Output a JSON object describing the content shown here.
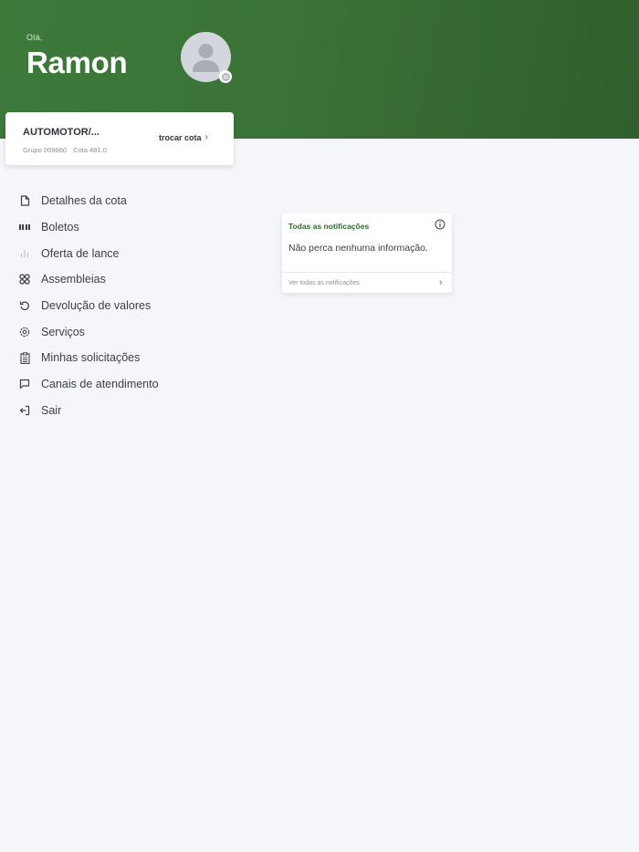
{
  "header": {
    "greeting": "Olá,",
    "user_name": "Ramon",
    "colors": {
      "gradient_start": "#3d7a3a",
      "gradient_end": "#2f5f2c"
    }
  },
  "quota_card": {
    "title": "AUTOMOTOR/...",
    "group": "Grupo 009660",
    "quota": "Cota 481.0",
    "switch_label": "trocar cota",
    "switch_icon": "chevron-right-icon"
  },
  "menu": {
    "items": [
      {
        "label": "Detalhes da cota",
        "icon": "document-icon"
      },
      {
        "label": "Boletos",
        "icon": "barcode-icon"
      },
      {
        "label": "Oferta de lance",
        "icon": "bar-chart-icon"
      },
      {
        "label": "Assembleias",
        "icon": "cluster-icon"
      },
      {
        "label": "Devolução de valores",
        "icon": "undo-icon"
      },
      {
        "label": "Serviços",
        "icon": "gear-icon"
      },
      {
        "label": "Minhas solicitações",
        "icon": "clipboard-icon"
      },
      {
        "label": "Canais de atendimento",
        "icon": "chat-icon"
      },
      {
        "label": "Sair",
        "icon": "logout-icon"
      }
    ]
  },
  "notifications": {
    "title": "Todas as notificações",
    "message": "Não perca nenhuma informação.",
    "link_label": "Ver todas as notificações",
    "accent_color": "#2e6a2b"
  }
}
